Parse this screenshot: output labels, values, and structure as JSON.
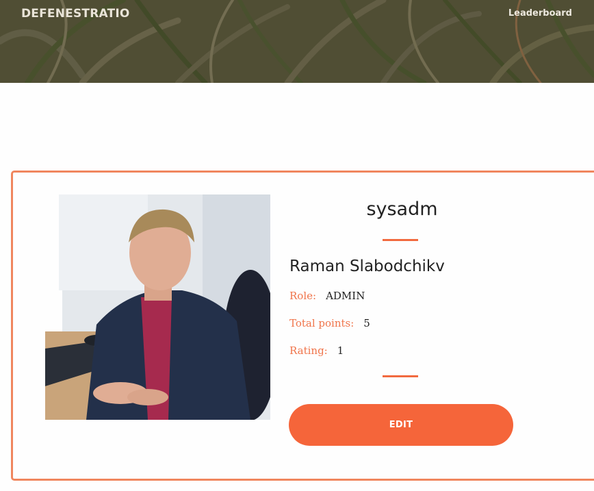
{
  "header": {
    "brand": "DEFENESTRATIO",
    "nav": {
      "leaderboard": "Leaderboard"
    }
  },
  "profile": {
    "username": "sysadm",
    "full_name": "Raman Slabodchikv",
    "fields": {
      "role": {
        "label": "Role:",
        "value": "ADMIN"
      },
      "total_points": {
        "label": "Total points:",
        "value": "5"
      },
      "rating": {
        "label": "Rating:",
        "value": "1"
      }
    },
    "edit_label": "EDIT"
  },
  "colors": {
    "accent": "#f5653a",
    "card_border": "#f0865e",
    "label": "#f0744a"
  },
  "icons": {
    "avatar": "user-photo"
  }
}
